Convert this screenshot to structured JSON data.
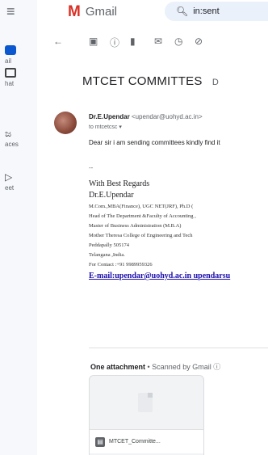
{
  "app": {
    "logo_text": "Gmail"
  },
  "rail": {
    "menu_glyph": "≡",
    "items": [
      {
        "label": "ail",
        "icon": "mail-icon"
      },
      {
        "label": "hat",
        "icon": "chat-icon"
      },
      {
        "label": "aces",
        "icon": "spaces-icon"
      },
      {
        "label": "eet",
        "icon": "meet-icon"
      }
    ]
  },
  "search": {
    "value": "in:sent"
  },
  "toolbar": {
    "icons": [
      "back-icon",
      "archive-icon",
      "report-spam-icon",
      "delete-icon",
      "mark-unread-icon",
      "snooze-icon",
      "add-task-icon"
    ]
  },
  "email": {
    "subject": "MTCET COMMITTES",
    "subject_label": "D",
    "sender_name": "Dr.E.Upendar",
    "sender_email": "<upendar@uohyd.ac.in>",
    "recipient": "to mtcetcsc ▾",
    "body": "Dear sir i am sending committees kindly find it",
    "signature_dash": "--",
    "signature": {
      "greeting": "With Best Regards",
      "name": "Dr.E.Upendar",
      "line1": "M.Com.,MBA(Finance), UGC NET(JRF), Ph.D (",
      "line2": "Head of The Department &Faculty of Accounting ,",
      "line3": "Master of Business Administration (M.B.A)",
      "line4": "Mother Theresa College of Engineering and Tech",
      "line5": "Peddapally 505174",
      "line6": "Telangana ,India.",
      "line7": "For Contact :+91 9989959326",
      "email_link": "E-mail:upendar@uohyd.ac.in upendarsu"
    }
  },
  "attachments": {
    "title": "One attachment",
    "scan_note": "• Scanned by Gmail ⓘ",
    "files": [
      {
        "name": "MTCET_Committe...",
        "type_glyph": "▤"
      }
    ]
  }
}
